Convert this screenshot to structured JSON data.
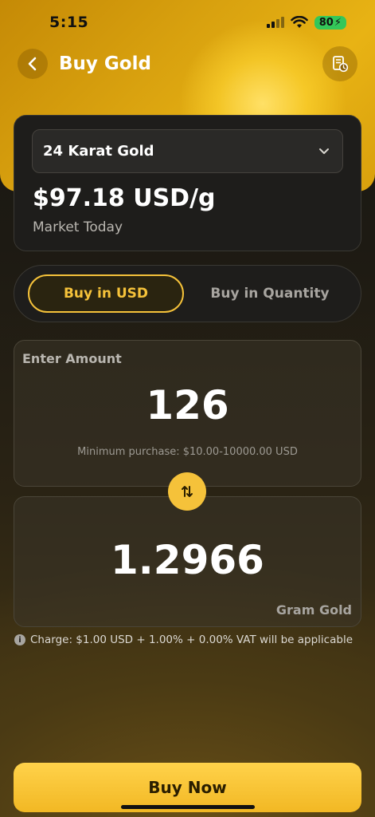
{
  "status_bar": {
    "time": "5:15",
    "battery": "80"
  },
  "nav": {
    "title": "Buy Gold"
  },
  "gold_card": {
    "selected_gold": "24 Karat Gold",
    "price": "$97.18 USD/g",
    "market_label": "Market Today"
  },
  "toggle": {
    "active_tab": "Buy in USD",
    "inactive_tab": "Buy in Quantity"
  },
  "amount_box": {
    "label": "Enter Amount",
    "value": "126",
    "min_note": "Minimum purchase: $10.00-10000.00 USD"
  },
  "quantity_box": {
    "value": "1.2966",
    "unit": "Gram Gold"
  },
  "charge_note": "Charge: $1.00 USD + 1.00% + 0.00% VAT will be applicable",
  "buy_button": {
    "label": "Buy Now"
  },
  "colors": {
    "accent": "#f5c23a",
    "card_bg": "#1e1d1b",
    "battery": "#34c759"
  }
}
